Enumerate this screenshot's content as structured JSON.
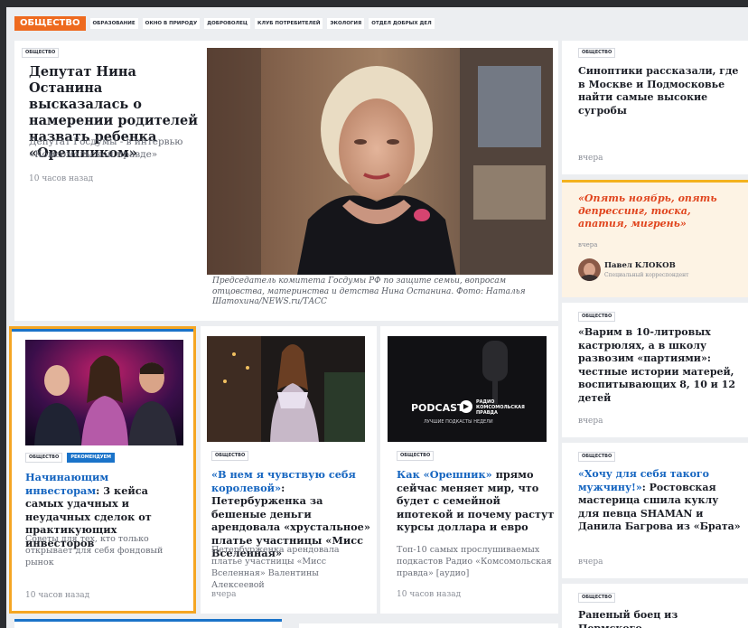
{
  "nav": {
    "section": "ОБЩЕСТВО",
    "items": [
      "ОБРАЗОВАНИЕ",
      "ОКНО В ПРИРОДУ",
      "ДОБРОВОЛЕЦ",
      "КЛУБ ПОТРЕБИТЕЛЕЙ",
      "ЭКОЛОГИЯ",
      "ОТДЕЛ ДОБРЫХ ДЕЛ"
    ]
  },
  "lead_story": {
    "tag": "ОБЩЕСТВО",
    "title": "Депутат Нина Останина высказалась о намерении родителей назвать ребенка «Орешником»",
    "lead": "Депутат Госдумы - в интервью «Комсомольской правде»",
    "time": "10 часов назад",
    "caption": "Председатель комитета Госдумы РФ по защите семьи, вопросам отцовства, материнства и детства Нина Останина. Фото: Наталья Шатохина/NEWS.ru/ТАСС"
  },
  "right": {
    "card1": {
      "tag": "ОБЩЕСТВО",
      "title": "Синоптики рассказали, где в Москве и Подмосковье найти самые высокие сугробы",
      "time": "вчера"
    },
    "opinion": {
      "title": "«Опять ноябрь, опять депрессинг, тоска, апатия, мигрень»",
      "time": "вчера",
      "author": "Павел КЛОКОВ",
      "role": "Специальный корреспондент"
    },
    "card2": {
      "tag": "ОБЩЕСТВО",
      "title": "«Варим в 10-литровых кастрюлях, а в школу развозим «партиями»: честные истории матерей, воспитывающих 8, 10 и 12 детей",
      "time": "вчера"
    },
    "card3": {
      "tag": "ОБЩЕСТВО",
      "title_a": "«Хочу для себя такого мужчину!»",
      "title_b": ": Ростовская мастерица сшила куклу для певца SHAMAN и Данила Багрова из «Брата»",
      "time": "вчера"
    },
    "card4": {
      "tag": "ОБЩЕСТВО",
      "title": "Раненый боец из Пермского"
    }
  },
  "row": {
    "c1": {
      "tag": "ОБЩЕСТВО",
      "tag2": "РЕКОМЕНДУЕМ",
      "title_a": "Начинающим инвесторам",
      "title_b": ": 3 кейса самых удачных и неудачных сделок от практикующих инвесторов",
      "lead": "Советы для тех, кто только открывает для себя фондовый рынок",
      "time": "10 часов назад"
    },
    "c2": {
      "tag": "ОБЩЕСТВО",
      "title_a": "«В нем я чувствую себя королевой»",
      "title_b": ": Петербурженка за бешеные деньги арендовала «хрустальное» платье участницы «Мисс Вселенная»",
      "lead": "Петербурженка арендовала платье участницы «Мисс Вселенная» Валентины Алексеевой",
      "time": "вчера"
    },
    "c3": {
      "tag": "ОБЩЕСТВО",
      "title_a": "Как «Орешник»",
      "title_b": " прямо сейчас меняет мир, что будет с семейной ипотекой и почему растут курсы доллара и евро",
      "lead": "Топ-10 самых прослушиваемых подкастов Радио «Комсомольская правда» [аудио]",
      "time": "10 часов назад",
      "podcast": "PODCAST",
      "radio": "РАДИО КОМСОМОЛЬСКАЯ ПРАВДА",
      "best": "ЛУЧШИЕ ПОДКАСТЫ НЕДЕЛИ"
    }
  }
}
